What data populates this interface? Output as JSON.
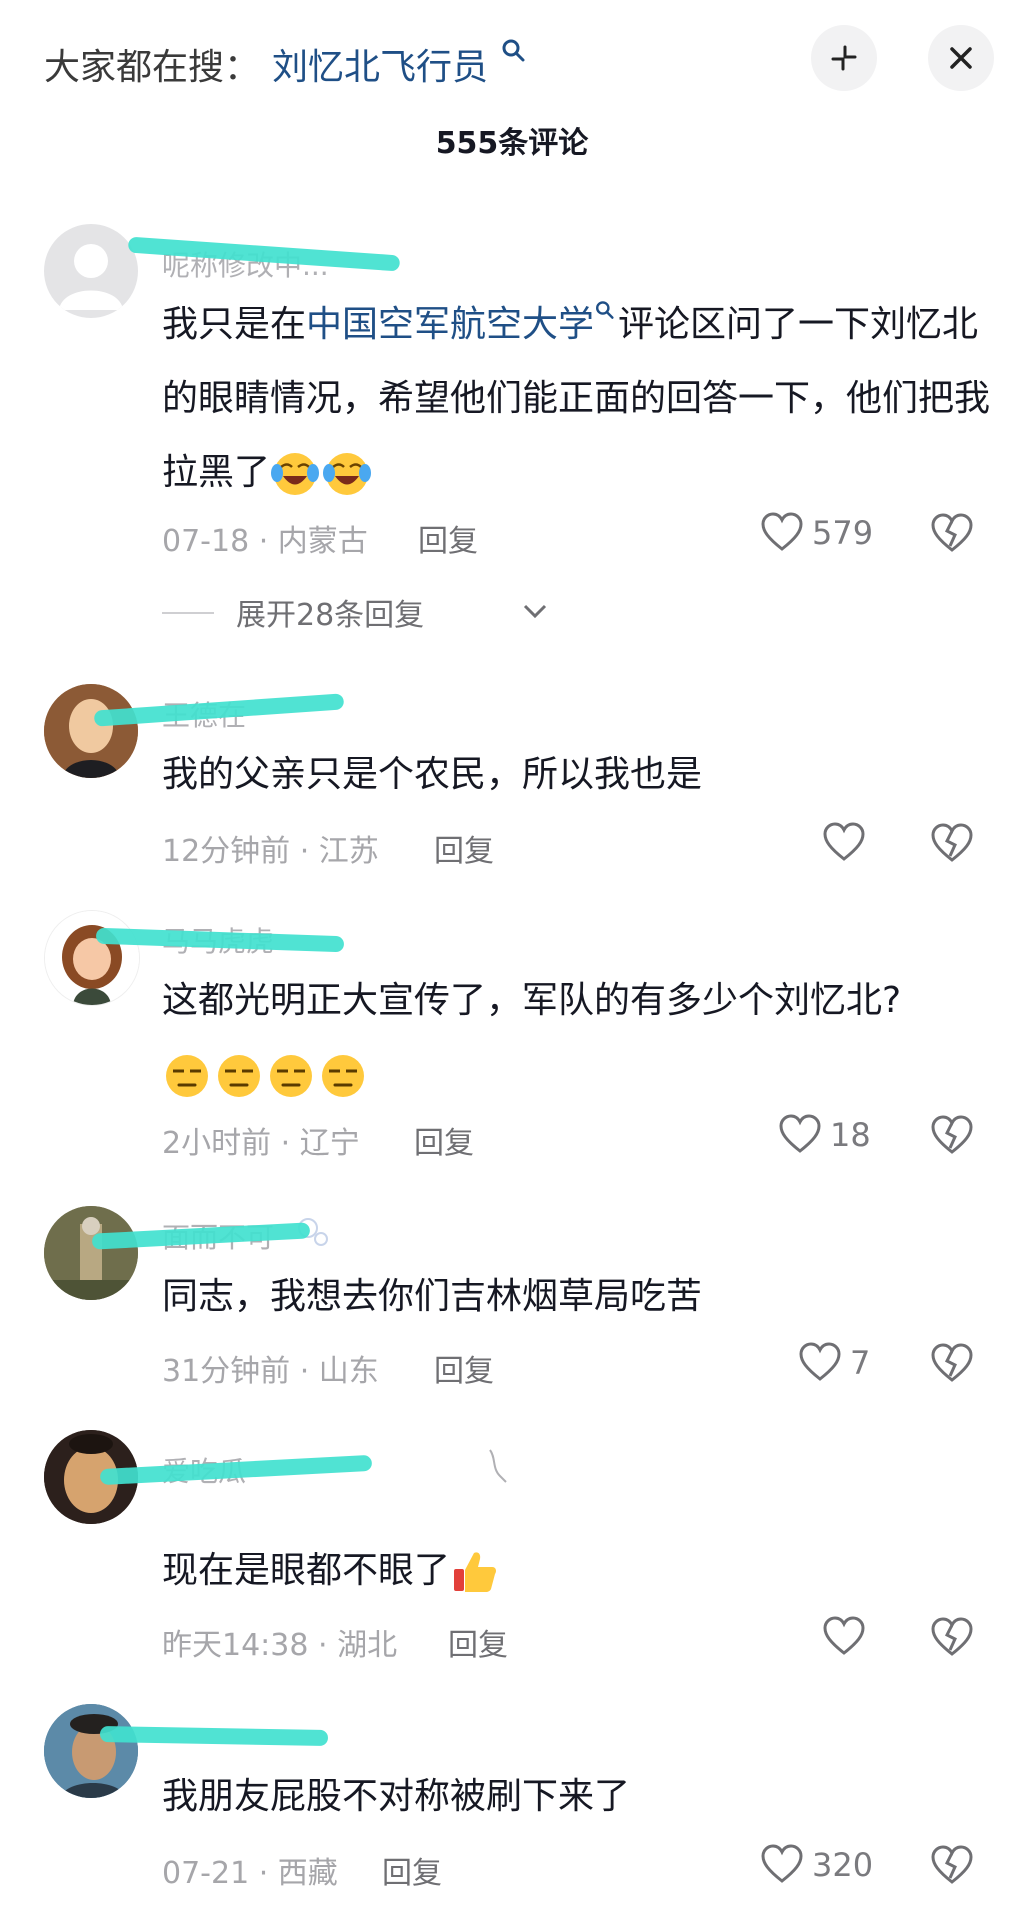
{
  "header": {
    "search_prefix": "大家都在搜：",
    "search_term": "刘忆北飞行员",
    "comment_count": "555条评论"
  },
  "comments": [
    {
      "username": "呢称修改中...",
      "text_before": "我只是在",
      "text_link": "中国空军航空大学",
      "text_after": "评论区问了一下刘忆北的眼睛情况，希望他们能正面的回答一下，他们把我拉黑了",
      "emojis": [
        "cry-laugh-emoji",
        "cry-laugh-emoji"
      ],
      "meta": "07-18 · 内蒙古",
      "reply_label": "回复",
      "likes": "579",
      "expand_label": "展开28条回复"
    },
    {
      "username": "王德在",
      "text": "我的父亲只是个农民，所以我也是",
      "meta": "12分钟前 · 江苏",
      "reply_label": "回复",
      "likes": ""
    },
    {
      "username": "马马虎虎",
      "text": "这都光明正大宣传了，军队的有多少个刘忆北?",
      "emojis": [
        "smirk-emoji",
        "smirk-emoji",
        "smirk-emoji",
        "smirk-emoji"
      ],
      "meta": "2小时前 · 辽宁",
      "reply_label": "回复",
      "likes": "18"
    },
    {
      "username": "面而不可",
      "text": "同志，我想去你们吉林烟草局吃苦",
      "meta": "31分钟前 · 山东",
      "reply_label": "回复",
      "likes": "7"
    },
    {
      "username": "爱吃瓜",
      "text": "现在是眼都不眼了",
      "emojis": [
        "thumbs-up-emoji"
      ],
      "meta": "昨天14:38 · 湖北",
      "reply_label": "回复",
      "likes": ""
    },
    {
      "username": "",
      "text": "我朋友屁股不对称被刷下来了",
      "meta": "07-21 · 西藏",
      "reply_label": "回复",
      "likes": "320"
    }
  ],
  "colors": {
    "link": "#1f4f86",
    "redaction_marker": "#41e1cf",
    "meta_gray": "#a6a6aa"
  }
}
